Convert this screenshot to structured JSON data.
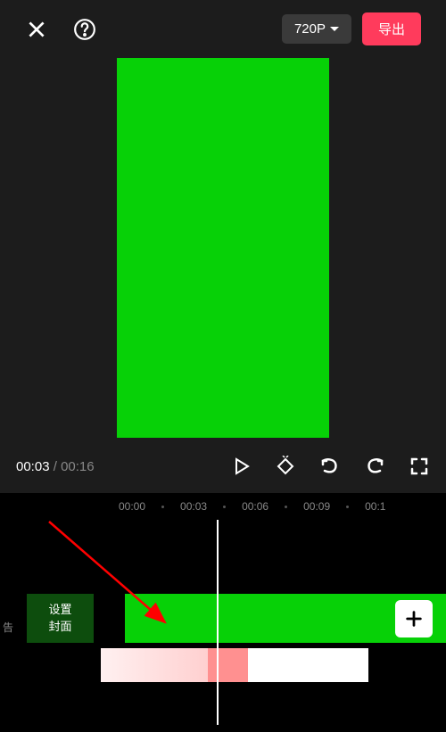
{
  "header": {
    "resolution": "720P",
    "export_label": "导出"
  },
  "player": {
    "current_time": "00:03",
    "total_time": "00:16"
  },
  "timeline": {
    "ruler": [
      "00:00",
      "00:03",
      "00:06",
      "00:09",
      "00:1"
    ],
    "cover_label_line1": "设置",
    "cover_label_line2": "封面",
    "side_label": "告"
  },
  "colors": {
    "video_green": "#07d107",
    "export_red": "#ff3b5c",
    "arrow_red": "#ff0000"
  }
}
